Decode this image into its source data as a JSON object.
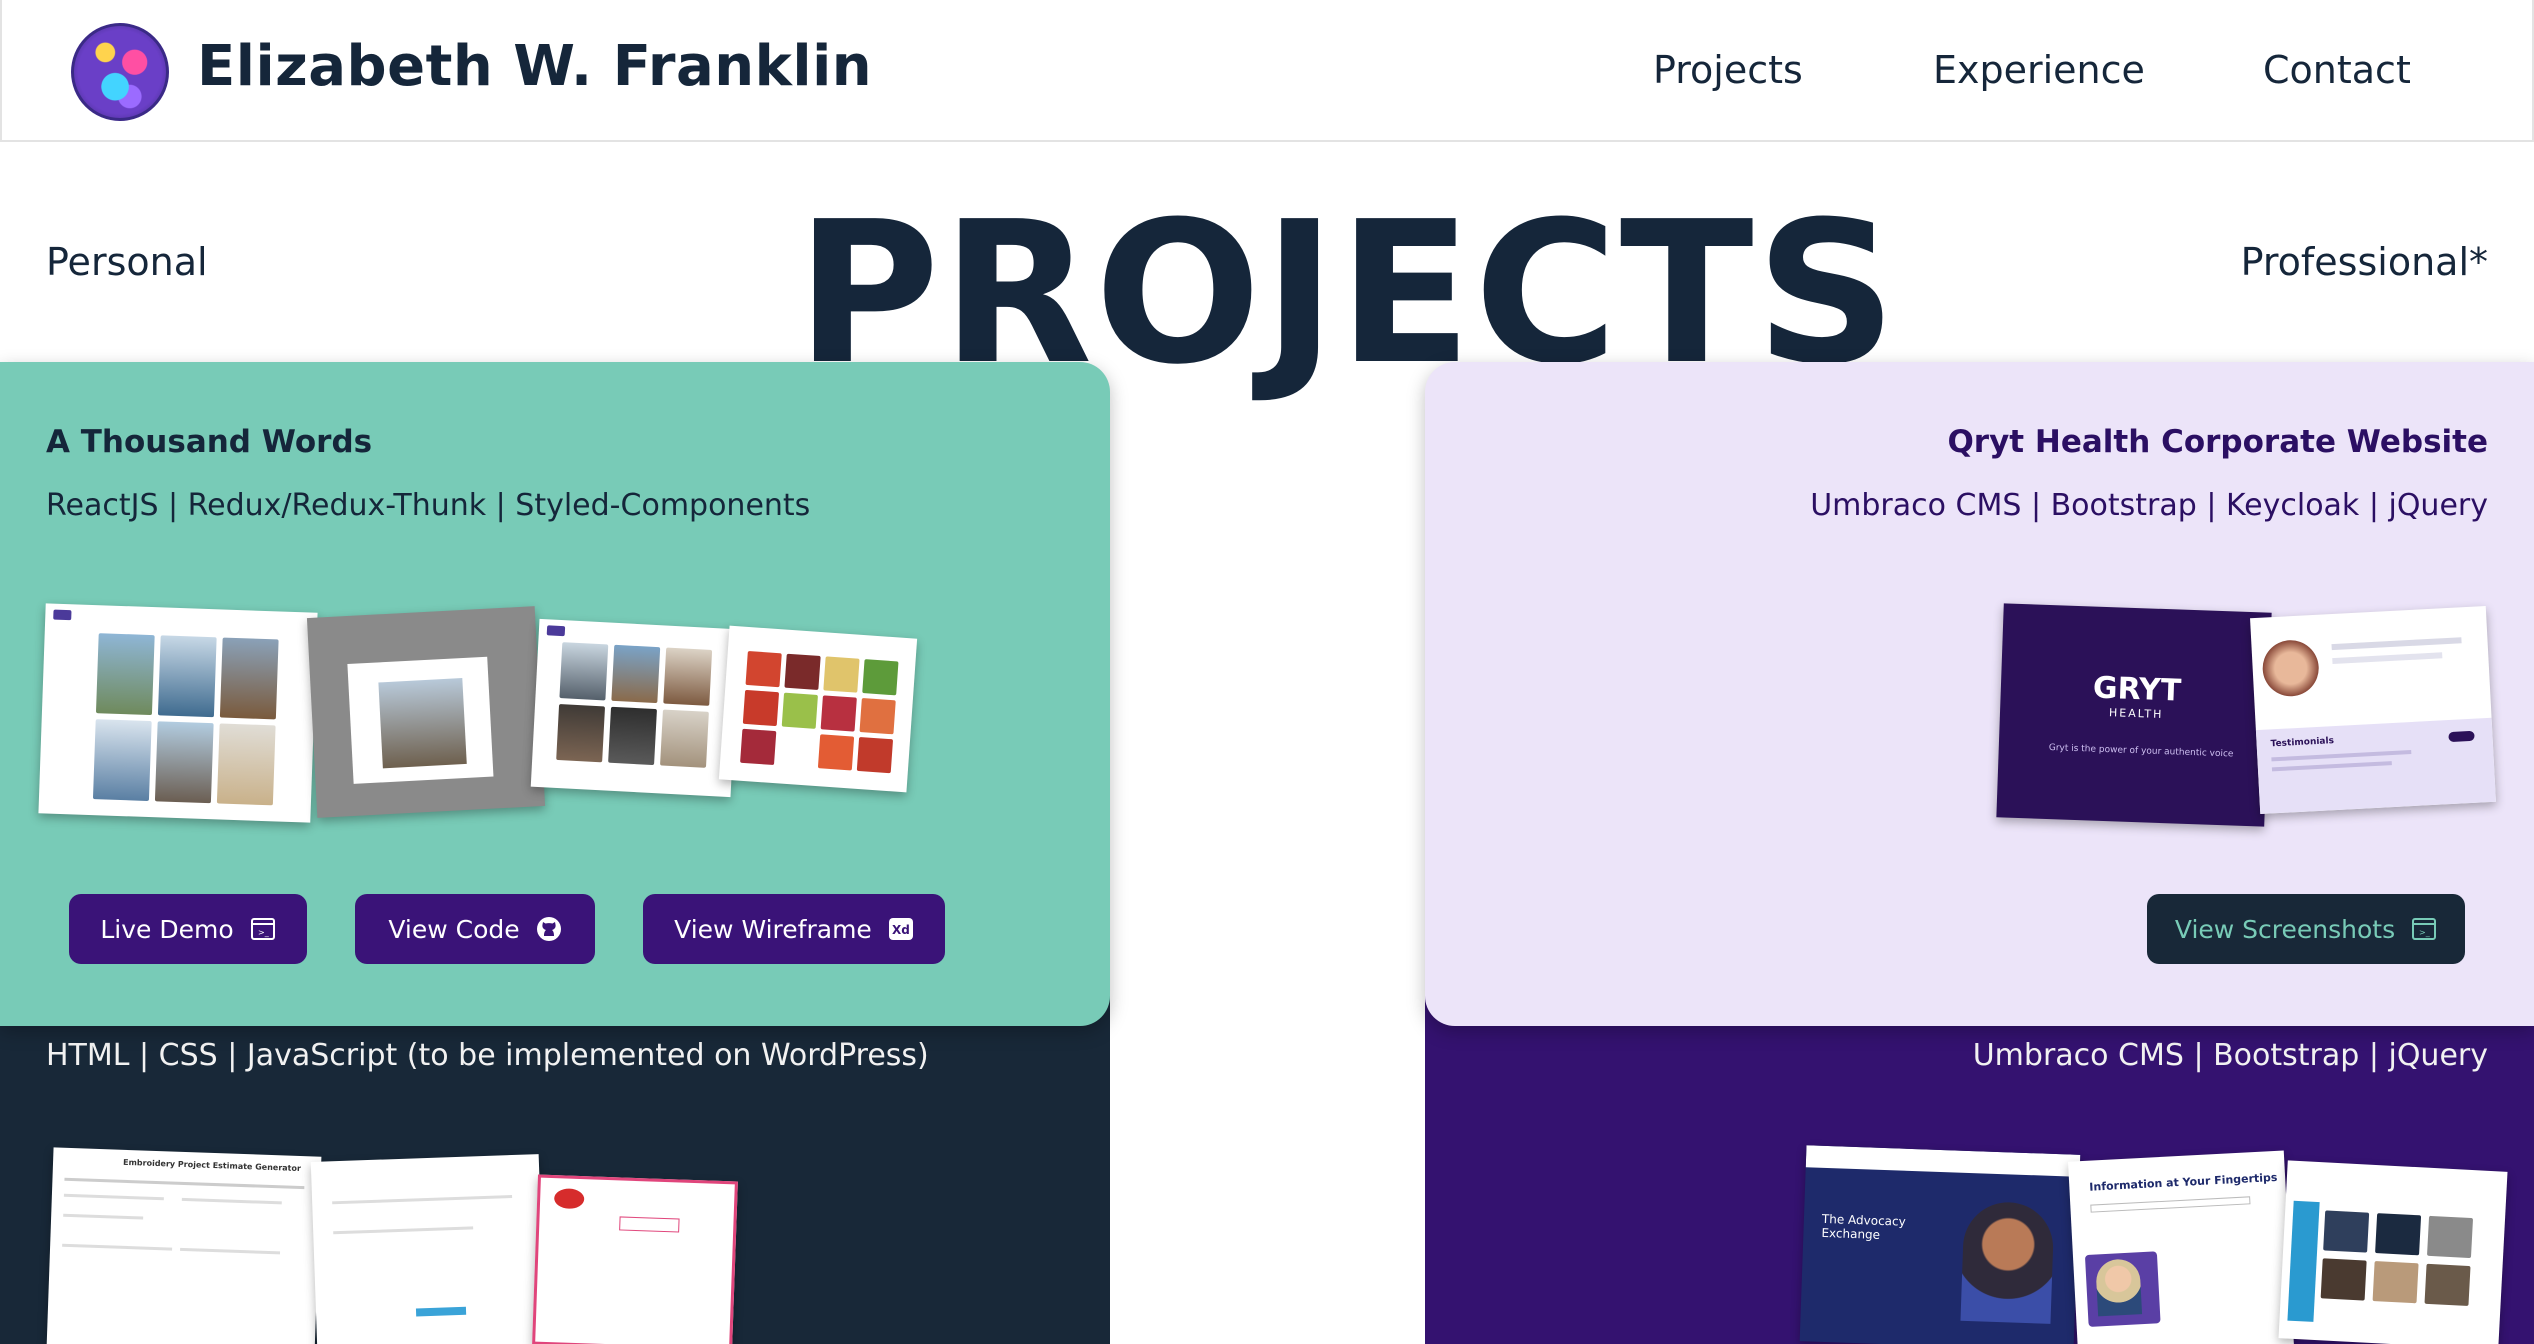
{
  "header": {
    "site_name": "Elizabeth W. Franklin",
    "nav": {
      "projects": "Projects",
      "experience": "Experience",
      "contact": "Contact"
    }
  },
  "section": {
    "title": "PROJECTS",
    "filter_personal": "Personal",
    "filter_professional": "Professional*"
  },
  "projects": {
    "thousand_words": {
      "title": "A Thousand Words",
      "stack": "ReactJS | Redux/Redux-Thunk | Styled-Components",
      "buttons": {
        "live_demo": "Live Demo",
        "view_code": "View Code",
        "view_wireframe": "View Wireframe"
      }
    },
    "gryt": {
      "title": "Qryt Health Corporate Website",
      "stack": "Umbraco CMS | Bootstrap | Keycloak | jQuery",
      "buttons": {
        "view_screenshots": "View Screenshots"
      },
      "thumb_logo": "GRYT",
      "thumb_logo_sub": "HEALTH",
      "thumb_tagline": "Gryt is the power of your authentic voice",
      "thumb_testimonials": "Testimonials"
    },
    "wordpress": {
      "stack": "HTML | CSS | JavaScript (to be implemented on WordPress)",
      "thumb_title": "Embroidery Project Estimate Generator"
    },
    "advocacy": {
      "stack": "Umbraco CMS | Bootstrap | jQuery",
      "thumb_heading": "The Advocacy Exchange",
      "thumb_fingertips": "Information at Your Fingertips"
    }
  },
  "icons": {
    "live_demo": "browser-window-icon",
    "view_code": "github-icon",
    "view_wireframe": "adobe-xd-icon",
    "view_screenshots": "browser-window-icon"
  },
  "colors": {
    "navy": "#15263a",
    "mint": "#78cbb7",
    "lavender": "#ece4f9",
    "purple": "#3a1378",
    "deep_purple": "#341270",
    "dark_slate": "#182838"
  }
}
